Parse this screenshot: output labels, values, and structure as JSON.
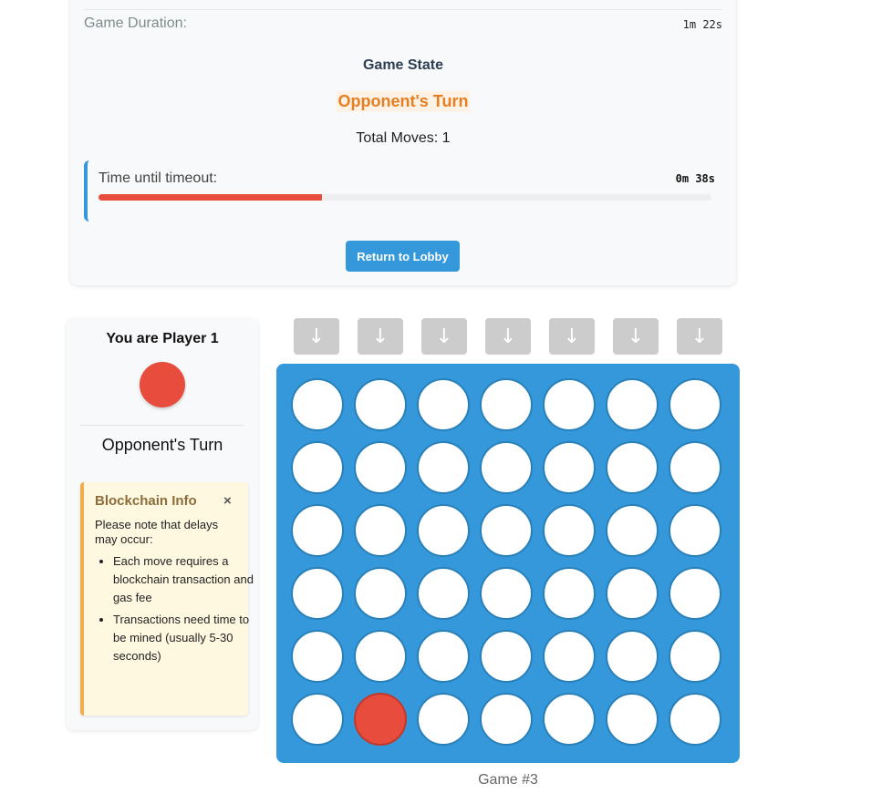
{
  "status": {
    "duration_label": "Game Duration:",
    "duration_value": "1m 22s",
    "state_title": "Game State",
    "turn_status": "Opponent's Turn",
    "total_moves": "Total Moves: 1",
    "timeout_label": "Time until timeout:",
    "timeout_value": "0m 38s",
    "timeout_progress_fraction": 0.365,
    "return_button": "Return to Lobby"
  },
  "player_panel": {
    "title": "You are Player 1",
    "player_color": "#e74c3c",
    "turn_text": "Opponent's Turn",
    "info": {
      "title": "Blockchain Info",
      "close_glyph": "×",
      "intro": "Please note that delays may occur:",
      "items": [
        "Each move requires a blockchain transaction and gas fee",
        "Transactions need time to be mined (usually 5-30 seconds)"
      ]
    }
  },
  "board": {
    "drop_glyph": "↓",
    "columns": 7,
    "rows": 6,
    "cells": [
      [
        0,
        0,
        0,
        0,
        0,
        0,
        0
      ],
      [
        0,
        0,
        0,
        0,
        0,
        0,
        0
      ],
      [
        0,
        0,
        0,
        0,
        0,
        0,
        0
      ],
      [
        0,
        0,
        0,
        0,
        0,
        0,
        0
      ],
      [
        0,
        0,
        0,
        0,
        0,
        0,
        0
      ],
      [
        0,
        1,
        0,
        0,
        0,
        0,
        0
      ]
    ],
    "player1_color": "#e74c3c",
    "board_color": "#3498db",
    "game_id": "Game #3"
  }
}
